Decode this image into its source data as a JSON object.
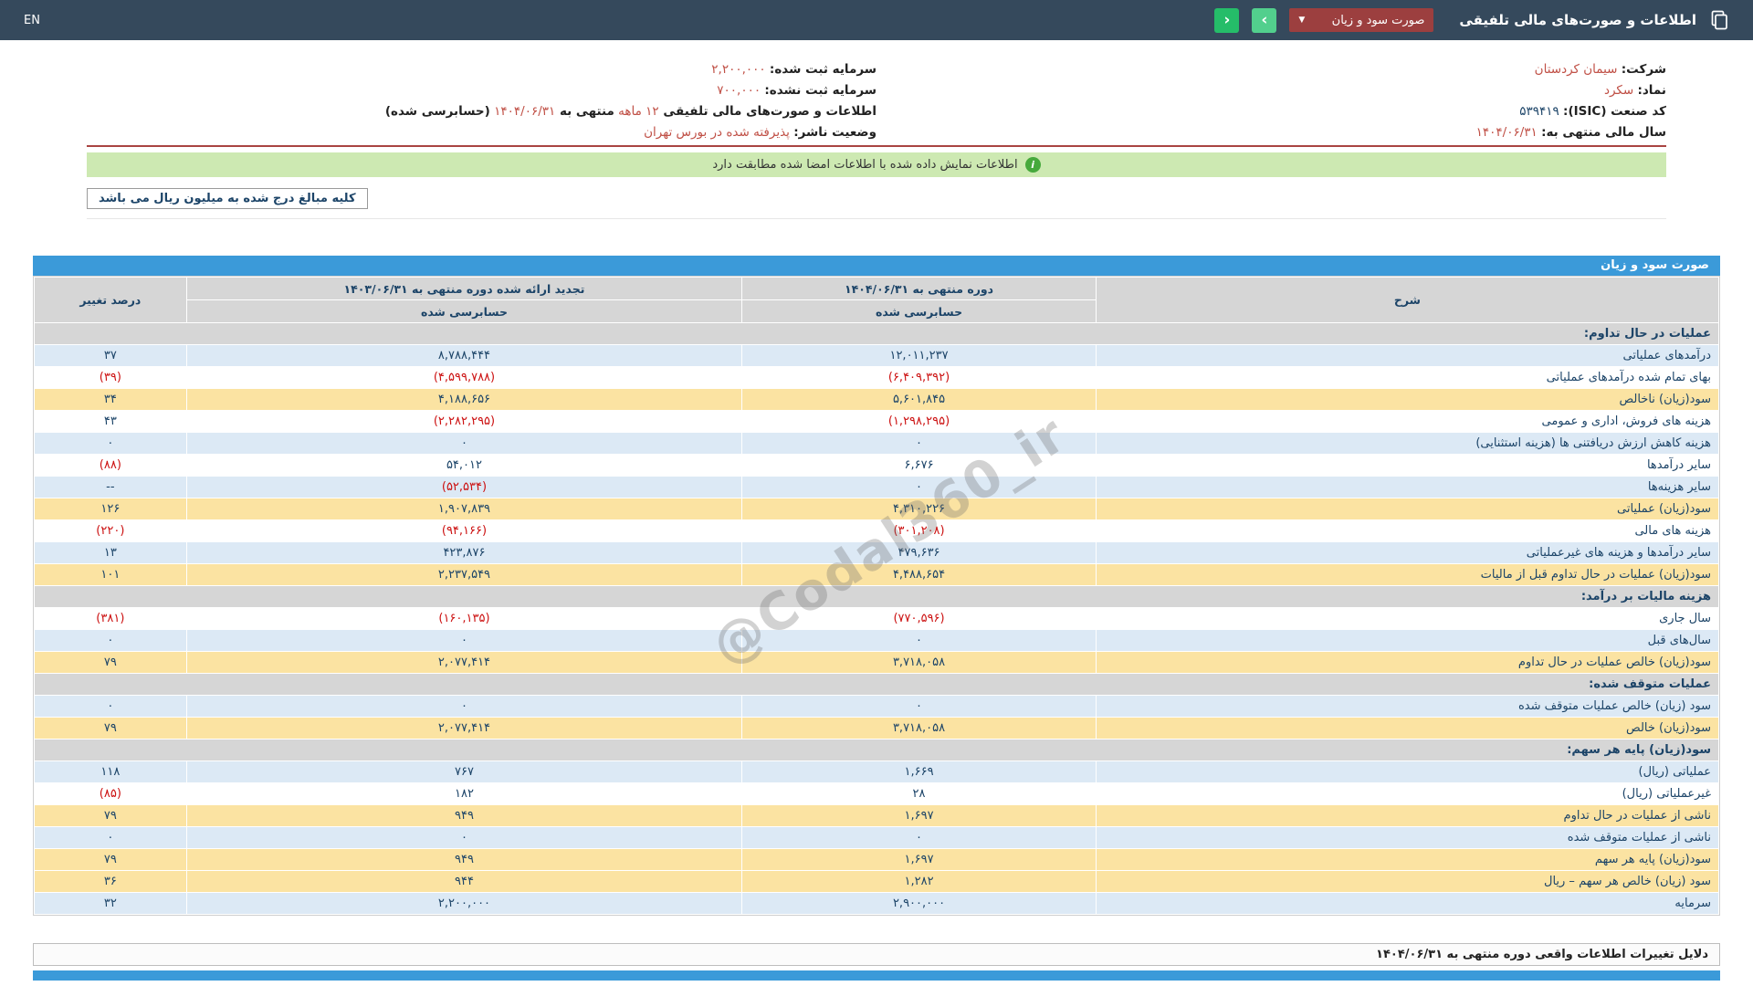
{
  "topbar": {
    "title": "اطلاعات و صورت‌های مالی تلفیقی",
    "dropdown_value": "صورت سود و زیان",
    "dropdown_caret": "▼",
    "nav_back": "‹",
    "nav_forward": "›",
    "language": "EN"
  },
  "company_info": {
    "company_label": "شرکت:",
    "company_value": "سیمان کردستان",
    "symbol_label": "نماد:",
    "symbol_value": "سکرد",
    "isic_label": "کد صنعت (ISIC):",
    "isic_value": "۵۳۹۴۱۹",
    "fiscal_year_label": "سال مالی منتهی به:",
    "fiscal_year_value": "۱۴۰۴/۰۶/۳۱",
    "registered_capital_label": "سرمایه ثبت شده:",
    "registered_capital_value": "۲,۲۰۰,۰۰۰",
    "unregistered_capital_label": "سرمایه ثبت نشده:",
    "unregistered_capital_value": "۷۰۰,۰۰۰",
    "period_label_1": "اطلاعات و صورت‌های مالی تلفیقی ",
    "period_value_1": "۱۲ ماهه",
    "period_label_2": "منتهی به ",
    "period_value_2": "۱۴۰۴/۰۶/۳۱",
    "period_label_3": "(حسابرسی شده)",
    "publisher_status_label": "وضعیت ناشر:",
    "publisher_status_value": "پذیرفته شده در بورس تهران"
  },
  "notice": {
    "icon_glyph": "i",
    "text": "اطلاعات نمایش داده شده با اطلاعات امضا شده مطابقت دارد"
  },
  "unit_note": "کلیه مبالغ درج شده به میلیون ریال می باشد",
  "statement": {
    "title": "صورت سود و زیان",
    "columns": {
      "description": "شرح",
      "current_period": "دوره منتهی به ۱۴۰۴/۰۶/۳۱",
      "prior_period": "تجدید ارائه شده دوره منتهی به ۱۴۰۳/۰۶/۳۱",
      "audited": "حسابرسی شده",
      "change_percent": "درصد تغییر"
    },
    "rows": [
      {
        "type": "section",
        "label": "عملیات در حال تداوم:",
        "current": "",
        "prior": "",
        "change": ""
      },
      {
        "type": "blue",
        "label": "درآمدهای عملیاتی",
        "current": "۱۲,۰۱۱,۲۳۷",
        "prior": "۸,۷۸۸,۴۴۴",
        "change": "۳۷"
      },
      {
        "type": "white",
        "label": "بهای تمام شده درآمدهای عملیاتی",
        "current": "(۶,۴۰۹,۳۹۲)",
        "prior": "(۴,۵۹۹,۷۸۸)",
        "change": "(۳۹)"
      },
      {
        "type": "yellow",
        "label": "سود(زیان) ناخالص",
        "current": "۵,۶۰۱,۸۴۵",
        "prior": "۴,۱۸۸,۶۵۶",
        "change": "۳۴"
      },
      {
        "type": "white",
        "label": "هزینه های فروش، اداری و عمومی",
        "current": "(۱,۲۹۸,۲۹۵)",
        "prior": "(۲,۲۸۲,۲۹۵)",
        "change": "۴۳"
      },
      {
        "type": "blue",
        "label": "هزینه کاهش ارزش دریافتنی ها (هزینه استثنایی)",
        "current": "۰",
        "prior": "۰",
        "change": "۰"
      },
      {
        "type": "white",
        "label": "سایر درآمدها",
        "current": "۶,۶۷۶",
        "prior": "۵۴,۰۱۲",
        "change": "(۸۸)"
      },
      {
        "type": "blue",
        "label": "سایر هزینه‌ها",
        "current": "۰",
        "prior": "(۵۲,۵۳۴)",
        "change": "--"
      },
      {
        "type": "yellow",
        "label": "سود(زیان) عملیاتی",
        "current": "۴,۳۱۰,۲۲۶",
        "prior": "۱,۹۰۷,۸۳۹",
        "change": "۱۲۶"
      },
      {
        "type": "white",
        "label": "هزینه های مالی",
        "current": "(۳۰۱,۲۰۸)",
        "prior": "(۹۴,۱۶۶)",
        "change": "(۲۲۰)"
      },
      {
        "type": "blue",
        "label": "سایر درآمدها و هزینه های غیرعملیاتی",
        "current": "۴۷۹,۶۳۶",
        "prior": "۴۲۳,۸۷۶",
        "change": "۱۳"
      },
      {
        "type": "yellow",
        "label": "سود(زیان) عملیات در حال تداوم قبل از مالیات",
        "current": "۴,۴۸۸,۶۵۴",
        "prior": "۲,۲۳۷,۵۴۹",
        "change": "۱۰۱"
      },
      {
        "type": "section",
        "label": "هزینه مالیات بر درآمد:",
        "current": "",
        "prior": "",
        "change": ""
      },
      {
        "type": "white",
        "label": "سال جاری",
        "current": "(۷۷۰,۵۹۶)",
        "prior": "(۱۶۰,۱۳۵)",
        "change": "(۳۸۱)"
      },
      {
        "type": "blue",
        "label": "سال‌های قبل",
        "current": "۰",
        "prior": "۰",
        "change": "۰"
      },
      {
        "type": "yellow",
        "label": "سود(زیان) خالص عملیات در حال تداوم",
        "current": "۳,۷۱۸,۰۵۸",
        "prior": "۲,۰۷۷,۴۱۴",
        "change": "۷۹"
      },
      {
        "type": "section",
        "label": "عملیات متوقف شده:",
        "current": "",
        "prior": "",
        "change": ""
      },
      {
        "type": "blue",
        "label": "سود (زیان) خالص عملیات متوقف شده",
        "current": "۰",
        "prior": "۰",
        "change": "۰"
      },
      {
        "type": "yellow",
        "label": "سود(زیان) خالص",
        "current": "۳,۷۱۸,۰۵۸",
        "prior": "۲,۰۷۷,۴۱۴",
        "change": "۷۹"
      },
      {
        "type": "section",
        "label": "سود(زیان) پایه هر سهم:",
        "current": "",
        "prior": "",
        "change": ""
      },
      {
        "type": "blue",
        "label": "عملیاتی (ریال)",
        "current": "۱,۶۶۹",
        "prior": "۷۶۷",
        "change": "۱۱۸"
      },
      {
        "type": "white",
        "label": "غیرعملیاتی (ریال)",
        "current": "۲۸",
        "prior": "۱۸۲",
        "change": "(۸۵)"
      },
      {
        "type": "yellow",
        "label": "ناشی از عملیات در حال تداوم",
        "current": "۱,۶۹۷",
        "prior": "۹۴۹",
        "change": "۷۹"
      },
      {
        "type": "blue",
        "label": "ناشی از عملیات متوقف شده",
        "current": "۰",
        "prior": "۰",
        "change": "۰"
      },
      {
        "type": "yellow",
        "label": "سود(زیان) پایه هر سهم",
        "current": "۱,۶۹۷",
        "prior": "۹۴۹",
        "change": "۷۹"
      },
      {
        "type": "yellow",
        "label": "سود (زیان) خالص هر سهم – ریال",
        "current": "۱,۲۸۲",
        "prior": "۹۴۴",
        "change": "۳۶"
      },
      {
        "type": "blue",
        "label": "سرمایه",
        "current": "۲,۹۰۰,۰۰۰",
        "prior": "۲,۲۰۰,۰۰۰",
        "change": "۳۲"
      }
    ]
  },
  "footer": {
    "reasons_title": "دلایل تغییرات اطلاعات واقعی دوره منتهی به ۱۴۰۴/۰۶/۳۱"
  },
  "watermark": "@Codal360_ir",
  "colors": {
    "topbar": "#35495c",
    "blue": "#3b9ad9",
    "gray": "#d6d6d6",
    "rowblue": "#dce9f5",
    "rowyellow": "#fbe3a2",
    "dropdown": "#9c3f3f",
    "green1": "#52cf8d",
    "green2": "#25bd69",
    "banner": "#cde9b2",
    "divider": "#a94442",
    "accent": "#c05046",
    "navy": "#1c4468",
    "negative": "#cc1111"
  }
}
